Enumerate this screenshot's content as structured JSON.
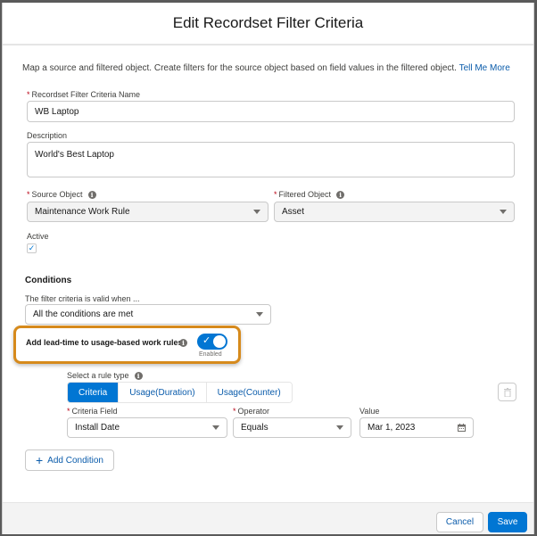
{
  "modal": {
    "title": "Edit Recordset Filter Criteria",
    "intro_text": "Map a source and filtered object. Create filters for the source object based on field values in the filtered object.",
    "intro_link": "Tell Me More"
  },
  "form": {
    "name_label": "Recordset Filter Criteria Name",
    "name_value": "WB Laptop",
    "description_label": "Description",
    "description_value": "World's Best Laptop",
    "source_object_label": "Source Object",
    "source_object_value": "Maintenance Work Rule",
    "filtered_object_label": "Filtered Object",
    "filtered_object_value": "Asset",
    "active_label": "Active",
    "active_checked": true
  },
  "conditions": {
    "title": "Conditions",
    "valid_when_label": "The filter criteria is valid when ...",
    "valid_when_value": "All the conditions are met",
    "lead_time_label": "Add lead-time to usage-based work rules",
    "lead_time_toggle_state": "Enabled",
    "lead_time_enabled": true,
    "rule_type_label": "Select a rule type",
    "rule_types": [
      "Criteria",
      "Usage(Duration)",
      "Usage(Counter)"
    ],
    "rule_type_selected": "Criteria",
    "criteria_field_label": "Criteria Field",
    "criteria_field_value": "Install Date",
    "operator_label": "Operator",
    "operator_value": "Equals",
    "value_label": "Value",
    "value_value": "Mar 1, 2023",
    "add_condition_label": "Add Condition"
  },
  "footer": {
    "cancel_label": "Cancel",
    "save_label": "Save"
  },
  "icons": {
    "info": "i",
    "checkmark": "✓",
    "plus": "+"
  },
  "colors": {
    "brand": "#0176d3",
    "highlight": "#d68a1c",
    "required": "#ba0517"
  }
}
